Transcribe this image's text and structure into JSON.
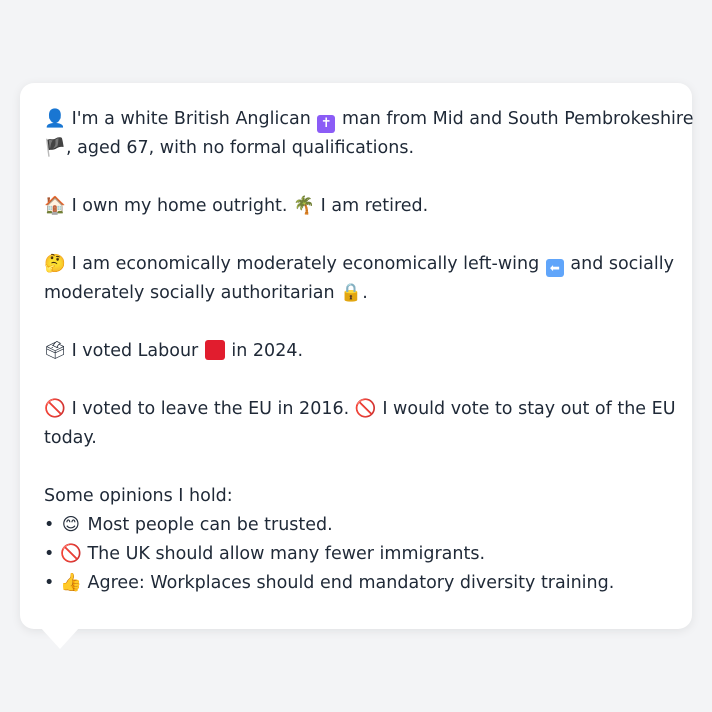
{
  "profile": {
    "p1": {
      "icon": "👤",
      "text_a": "I'm a white British Anglican",
      "religion_icon": "✝",
      "text_b": "man from Mid and South Pembrokeshire",
      "flag_icon": "🏴",
      "text_c": ", aged 67, with no formal qualifications."
    },
    "p2": {
      "home_icon": "🏠",
      "home_text": "I own my home outright.",
      "retired_icon": "🌴",
      "retired_text": "I am retired."
    },
    "p3": {
      "icon": "🤔",
      "text_a": "I am economically moderately economically left-wing",
      "left_icon": "⬅",
      "text_b": "and socially",
      "text_c": "moderately socially authoritarian",
      "lock_icon": "🔒",
      "text_d": "."
    },
    "p4": {
      "icon": "🗳",
      "text_a": "I voted Labour",
      "text_b": "in 2024.",
      "party_color": "#e11d2e"
    },
    "p5": {
      "icon_a": "🚫",
      "text_a": "I voted to leave the EU in 2016.",
      "icon_b": "🚫",
      "text_b": "I would vote to stay out of the EU",
      "text_c": "today."
    },
    "opinions": {
      "heading": "Some opinions I hold:",
      "items": [
        {
          "bullet": "•",
          "icon": "😊",
          "text": "Most people can be trusted."
        },
        {
          "bullet": "•",
          "icon": "🚫",
          "text": "The UK should allow many fewer immigrants."
        },
        {
          "bullet": "•",
          "icon": "👍",
          "text": "Agree: Workplaces should end mandatory diversity training."
        }
      ]
    }
  }
}
